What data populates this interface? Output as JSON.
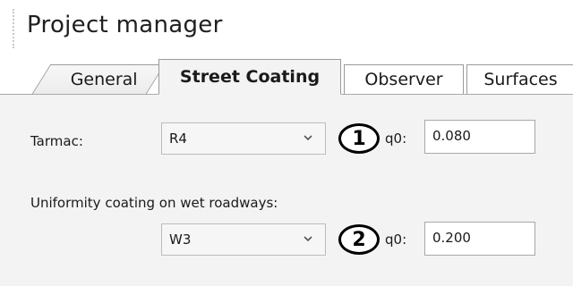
{
  "window": {
    "title": "Project manager"
  },
  "tabs": [
    {
      "label": "General",
      "active": false
    },
    {
      "label": "Street Coating",
      "active": true
    },
    {
      "label": "Observer",
      "active": false
    },
    {
      "label": "Surfaces",
      "active": false
    }
  ],
  "street_coating": {
    "tarmac": {
      "label": "Tarmac:",
      "selected": "R4",
      "badge": "1",
      "q0_label": "q0:",
      "q0_value": "0.080"
    },
    "uniformity": {
      "label": "Uniformity coating on wet roadways:",
      "selected": "W3",
      "badge": "2",
      "q0_label": "q0:",
      "q0_value": "0.200"
    }
  },
  "icons": {
    "dropdown": "chevron-down-icon"
  }
}
